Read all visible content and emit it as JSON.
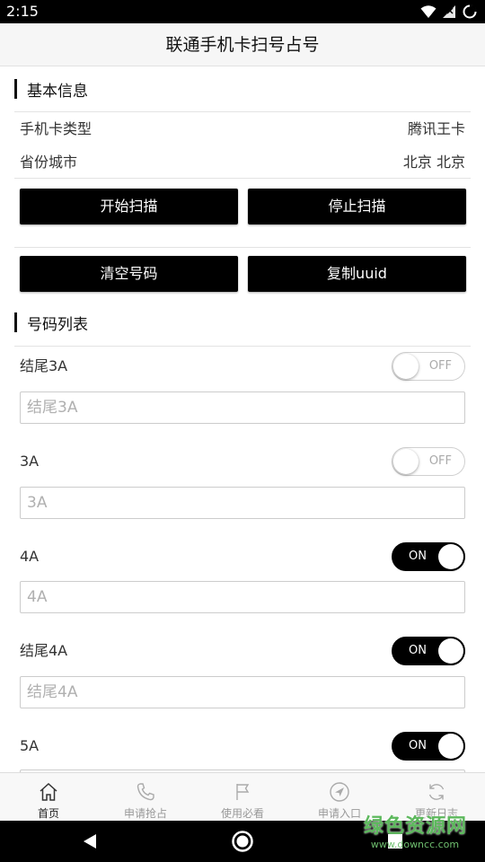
{
  "status_bar": {
    "time": "2:15"
  },
  "header": {
    "title": "联通手机卡扫号占号"
  },
  "basic_info": {
    "section_title": "基本信息",
    "card_type_label": "手机卡类型",
    "card_type_value": "腾讯王卡",
    "city_label": "省份城市",
    "city_value": "北京 北京"
  },
  "actions": {
    "start_scan": "开始扫描",
    "stop_scan": "停止扫描",
    "clear_numbers": "清空号码",
    "copy_uuid": "复制uuid"
  },
  "number_list": {
    "section_title": "号码列表",
    "options": [
      {
        "label": "结尾3A",
        "toggle_text": "OFF",
        "toggle_on": false,
        "placeholder": "结尾3A"
      },
      {
        "label": "3A",
        "toggle_text": "OFF",
        "toggle_on": false,
        "placeholder": "3A"
      },
      {
        "label": "4A",
        "toggle_text": "ON",
        "toggle_on": true,
        "placeholder": "4A"
      },
      {
        "label": "结尾4A",
        "toggle_text": "ON",
        "toggle_on": true,
        "placeholder": "结尾4A"
      },
      {
        "label": "5A",
        "toggle_text": "ON",
        "toggle_on": true,
        "placeholder": ""
      }
    ]
  },
  "tabs": [
    {
      "label": "首页",
      "icon": "home-icon",
      "active": true
    },
    {
      "label": "申请抢占",
      "icon": "phone-icon",
      "active": false
    },
    {
      "label": "使用必看",
      "icon": "flag-icon",
      "active": false
    },
    {
      "label": "申请入口",
      "icon": "navigation-icon",
      "active": false
    },
    {
      "label": "更新日志",
      "icon": "refresh-icon",
      "active": false
    }
  ],
  "watermark": {
    "line1": "绿色资源网",
    "line2": "www.downcc.com"
  },
  "colors": {
    "accent": "#000000",
    "tab_inactive": "#999999",
    "watermark": "#5cb85c"
  }
}
